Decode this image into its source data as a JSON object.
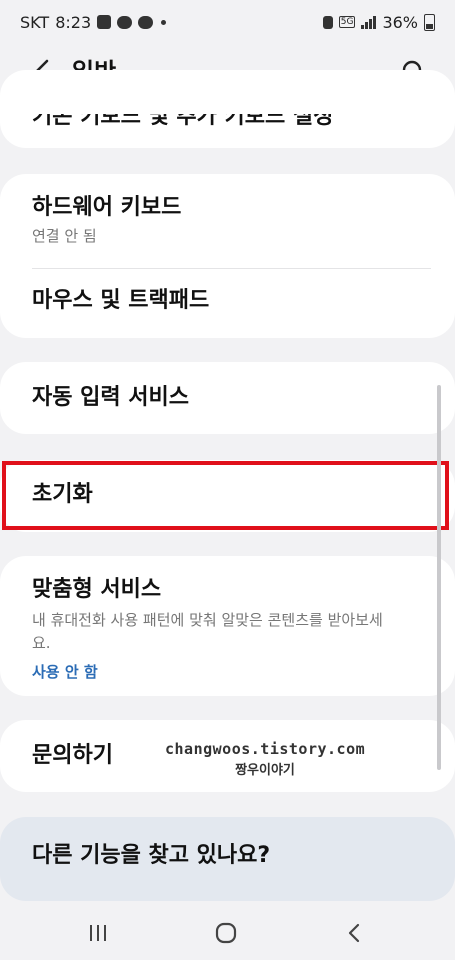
{
  "status_bar": {
    "carrier": "SKT",
    "time": "8:23",
    "network": "5G",
    "battery": "36%"
  },
  "app_bar": {
    "title": "일반"
  },
  "list": {
    "cut_item_label": "기본 키보드 및 추가 키보드 설정",
    "hardware_keyboard": {
      "title": "하드웨어 키보드",
      "subtitle": "연결 안 됨"
    },
    "mouse_trackpad": {
      "title": "마우스 및 트랙패드"
    },
    "autofill": {
      "title": "자동 입력 서비스"
    },
    "reset": {
      "title": "초기화"
    },
    "custom_service": {
      "title": "맞춤형 서비스",
      "description": "내 휴대전화 사용 패턴에 맞춰 알맞은 콘텐츠를 받아보세요.",
      "status": "사용 안 함"
    },
    "contact_us": {
      "title": "문의하기"
    }
  },
  "watermark": {
    "line1": "changwoos.tistory.com",
    "line2": "짱우이야기"
  },
  "suggestion": {
    "text": "다른 기능을 찾고 있나요?"
  },
  "icons": {
    "back": "chevron-left-icon",
    "search": "search-icon",
    "recents": "recents-icon",
    "home": "home-icon",
    "nav_back": "nav-back-icon"
  },
  "colors": {
    "highlight": "#e0101a",
    "link": "#2b6cb5",
    "background": "#f2f2f4",
    "card": "#ffffff",
    "suggestion_card": "#e3e8ef"
  }
}
